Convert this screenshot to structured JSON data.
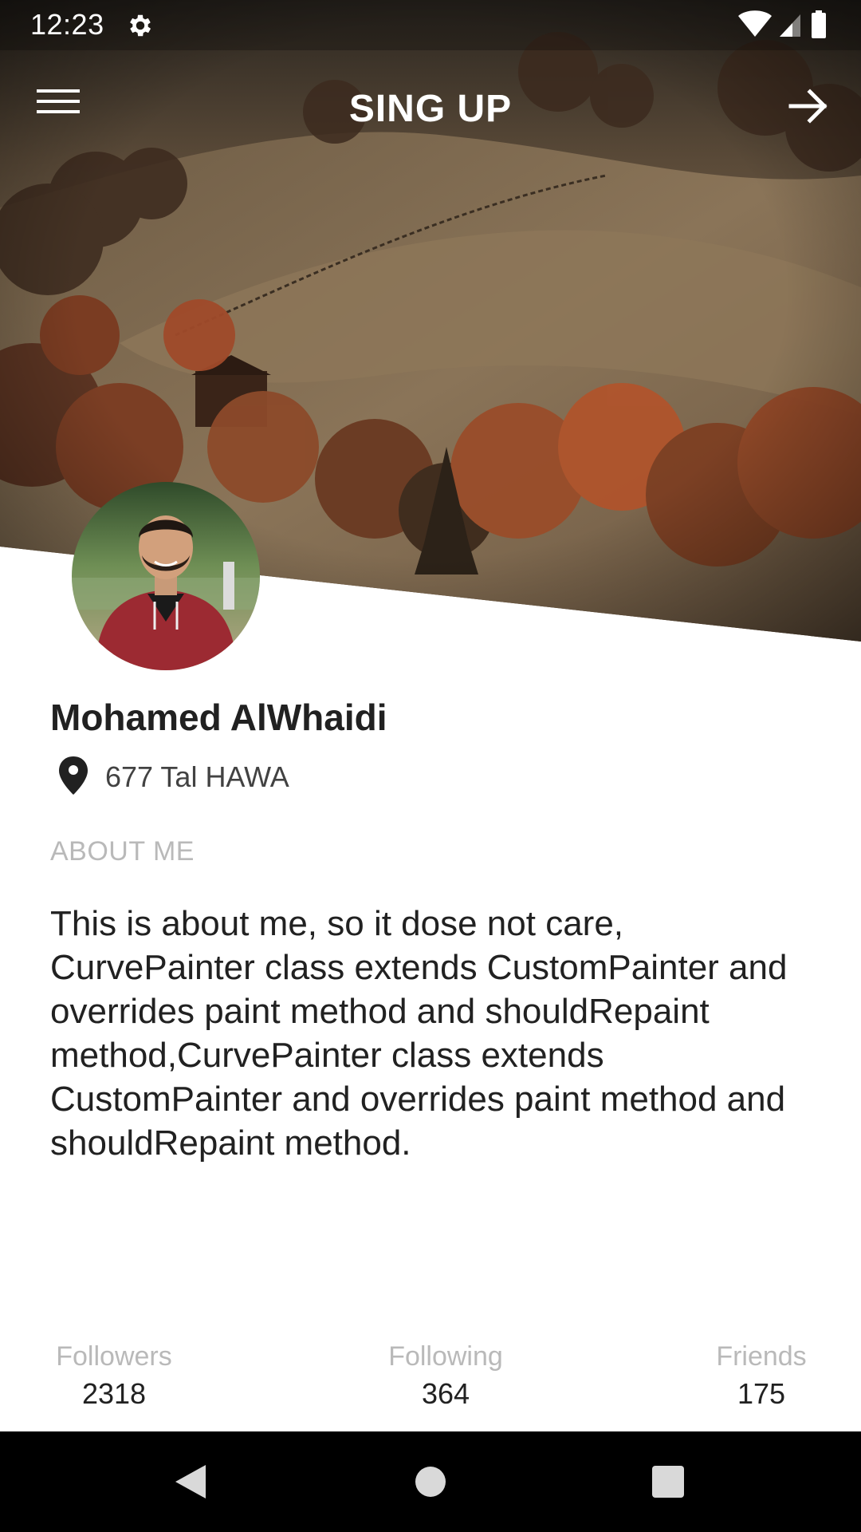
{
  "status_bar": {
    "time": "12:23",
    "settings_icon": "gear-icon",
    "wifi_icon": "wifi-icon",
    "signal_icon": "signal-icon",
    "battery_icon": "battery-icon"
  },
  "app_bar": {
    "title": "SING UP",
    "menu_icon": "hamburger-menu-icon",
    "forward_icon": "arrow-forward-icon"
  },
  "profile": {
    "name": "Mohamed AlWhaidi",
    "location_icon": "location-pin-icon",
    "location": "677 Tal HAWA",
    "about_heading": "ABOUT ME",
    "about_text": "This is about me, so it dose not care, CurvePainter class extends CustomPainter and overrides paint method and shouldRepaint method,CurvePainter class extends CustomPainter and overrides paint method and shouldRepaint method."
  },
  "stats": [
    {
      "label": "Followers",
      "value": "2318"
    },
    {
      "label": "Following",
      "value": "364"
    },
    {
      "label": "Friends",
      "value": "175"
    }
  ],
  "nav_bar": {
    "back_icon": "nav-back-icon",
    "home_icon": "nav-home-icon",
    "recents_icon": "nav-recents-icon"
  },
  "colors": {
    "text_primary": "#212121",
    "text_muted": "#b9b9b9",
    "nav_background": "#000000",
    "header_text": "#ffffff"
  }
}
